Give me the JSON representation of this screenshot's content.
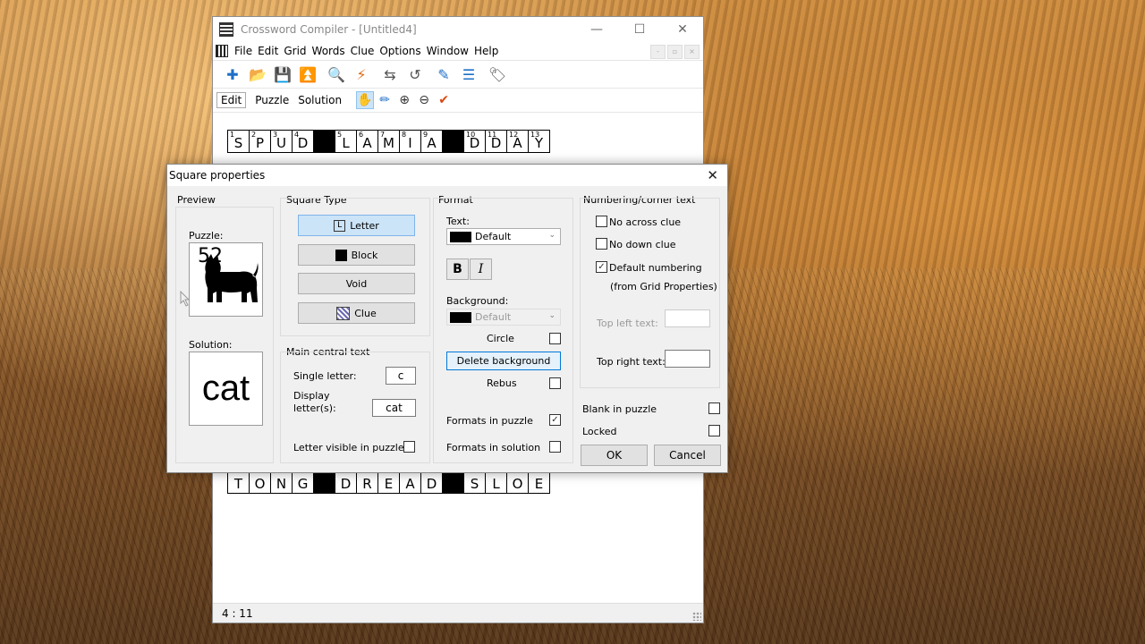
{
  "app": {
    "title": "Crossword Compiler - [Untitled4]",
    "controls": {
      "minimize": "—",
      "maximize": "☐",
      "close": "✕"
    },
    "menu": [
      "File",
      "Edit",
      "Grid",
      "Words",
      "Clue",
      "Options",
      "Window",
      "Help"
    ],
    "mdi_controls": [
      "-",
      "▫",
      "×"
    ],
    "toolbar": [
      {
        "icon": "plus-icon",
        "glyph": "✚",
        "cls": "blue"
      },
      {
        "icon": "open-folder-icon",
        "glyph": "📂",
        "cls": "blue"
      },
      {
        "icon": "save-icon",
        "glyph": "💾",
        "cls": "blue"
      },
      {
        "icon": "upload-icon",
        "glyph": "⏫",
        "cls": "blue"
      },
      {
        "icon": "search-icon",
        "glyph": "🔍",
        "cls": "orange"
      },
      {
        "icon": "lightning-icon",
        "glyph": "⚡",
        "cls": "orange"
      },
      {
        "icon": "swap-icon",
        "glyph": "⇆",
        "cls": "gray"
      },
      {
        "icon": "undo-icon",
        "glyph": "↺",
        "cls": "gray"
      },
      {
        "icon": "edit-icon",
        "glyph": "✎",
        "cls": "blue"
      },
      {
        "icon": "list-icon",
        "glyph": "☰",
        "cls": "blue"
      },
      {
        "icon": "tag-icon",
        "glyph": "🏷",
        "cls": "gray"
      }
    ],
    "tabs": [
      "Edit",
      "Puzzle",
      "Solution"
    ],
    "tab_icons": [
      {
        "icon": "pointer-icon",
        "glyph": "✋"
      },
      {
        "icon": "pencil-icon",
        "glyph": "✏"
      },
      {
        "icon": "zoom-in-icon",
        "glyph": "⊕"
      },
      {
        "icon": "zoom-out-icon",
        "glyph": "⊖"
      },
      {
        "icon": "checkmark-icon",
        "glyph": "✔"
      }
    ],
    "status": "4 : 11"
  },
  "grid": {
    "row1": [
      {
        "n": "1",
        "l": "S"
      },
      {
        "n": "2",
        "l": "P"
      },
      {
        "n": "3",
        "l": "U"
      },
      {
        "n": "4",
        "l": "D"
      },
      {
        "b": true
      },
      {
        "n": "5",
        "l": "L"
      },
      {
        "n": "6",
        "l": "A"
      },
      {
        "n": "7",
        "l": "M"
      },
      {
        "n": "8",
        "l": "I"
      },
      {
        "n": "9",
        "l": "A"
      },
      {
        "b": true
      },
      {
        "n": "10",
        "l": "D"
      },
      {
        "n": "11",
        "l": "D"
      },
      {
        "n": "12",
        "l": "A"
      },
      {
        "n": "13",
        "l": "Y"
      }
    ],
    "row_last": [
      {
        "l": "T"
      },
      {
        "l": "O"
      },
      {
        "l": "N"
      },
      {
        "l": "G"
      },
      {
        "b": true
      },
      {
        "l": "D"
      },
      {
        "l": "R"
      },
      {
        "l": "E"
      },
      {
        "l": "A"
      },
      {
        "l": "D"
      },
      {
        "b": true
      },
      {
        "l": "S"
      },
      {
        "l": "L"
      },
      {
        "l": "O"
      },
      {
        "l": "E"
      }
    ]
  },
  "dialog": {
    "title": "Square properties",
    "close": "✕",
    "preview": {
      "label": "Preview",
      "puzzle_label": "Puzzle:",
      "puzzle_number": "52",
      "solution_label": "Solution:",
      "solution_text": "cat"
    },
    "square_type": {
      "label": "Square Type",
      "letter": "Letter",
      "letter_glyph": "L",
      "block": "Block",
      "void": "Void",
      "clue": "Clue"
    },
    "main_text": {
      "label": "Main central text",
      "single_letter_label": "Single letter:",
      "single_letter": "c",
      "display_label_1": "Display",
      "display_label_2": "letter(s):",
      "display_value": "cat",
      "visible_label": "Letter visible in puzzle"
    },
    "format": {
      "label": "Format",
      "text_label": "Text:",
      "text_value": "Default",
      "bold": "B",
      "italic": "I",
      "background_label": "Background:",
      "background_value": "Default",
      "circle_label": "Circle",
      "delete_bg": "Delete background",
      "rebus_label": "Rebus",
      "formats_puzzle_label": "Formats in puzzle",
      "formats_puzzle_checked": "✓",
      "formats_solution_label": "Formats in solution"
    },
    "numbering": {
      "label": "Numbering/corner text",
      "no_across": "No across clue",
      "no_down": "No down clue",
      "default_numbering": "Default numbering",
      "default_checked": "✓",
      "from_grid": "(from Grid Properties)",
      "top_left": "Top left text:",
      "top_right": "Top right text:"
    },
    "blank_label": "Blank in puzzle",
    "locked_label": "Locked",
    "ok": "OK",
    "cancel": "Cancel"
  }
}
